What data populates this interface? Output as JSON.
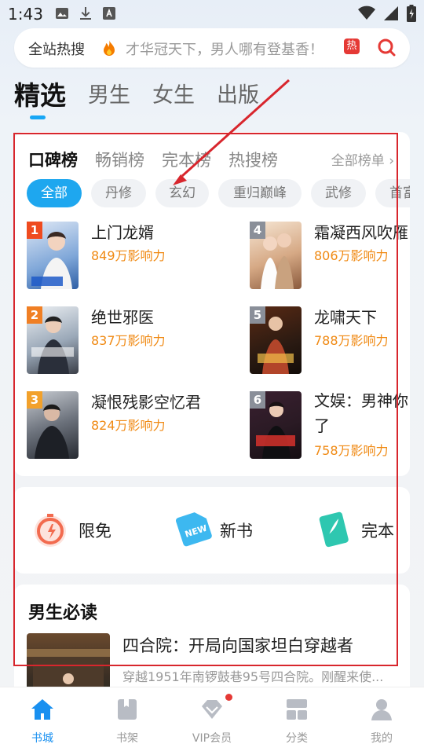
{
  "status_bar": {
    "time": "1:43"
  },
  "search": {
    "hot_label": "全站热搜",
    "placeholder": "才华冠天下，男人哪有登基香！",
    "hot_badge": "热"
  },
  "main_tabs": [
    "精选",
    "男生",
    "女生",
    "出版"
  ],
  "rank": {
    "tabs": [
      "口碑榜",
      "畅销榜",
      "完本榜",
      "热搜榜"
    ],
    "all_label": "全部榜单",
    "chips": [
      "全部",
      "丹修",
      "玄幻",
      "重归巅峰",
      "武修",
      "首富"
    ],
    "books": [
      {
        "rank": "1",
        "title": "上门龙婿",
        "impact": "849万影响力"
      },
      {
        "rank": "2",
        "title": "绝世邪医",
        "impact": "837万影响力"
      },
      {
        "rank": "3",
        "title": "凝恨残影空忆君",
        "impact": "824万影响力"
      },
      {
        "rank": "4",
        "title": "霜凝西风吹雁",
        "impact": "806万影响力"
      },
      {
        "rank": "5",
        "title": "龙啸天下",
        "impact": "788万影响力"
      },
      {
        "rank": "6",
        "title_line1": "文娱：男神你",
        "title_line2": "了",
        "impact": "758万影响力"
      }
    ]
  },
  "quick": [
    "限免",
    "新书",
    "完本"
  ],
  "must_read": {
    "title": "男生必读",
    "book_title": "四合院：开局向国家坦白穿越者",
    "book_desc": "穿越1951年南锣鼓巷95号四合院。刚醒来使..."
  },
  "bottom_nav": [
    "书城",
    "书架",
    "VIP会员",
    "分类",
    "我的"
  ],
  "colors": {
    "accent": "#1ea7ef",
    "impact": "#f08a14",
    "annotation": "#d8262d"
  }
}
